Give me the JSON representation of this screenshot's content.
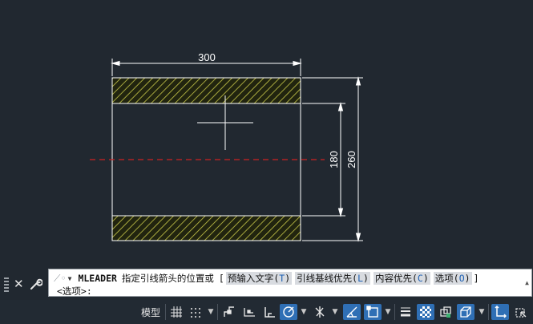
{
  "drawing": {
    "dimensions": {
      "top_width": "300",
      "inner_height": "180",
      "outer_height": "260"
    },
    "colors": {
      "hatch": "#c8c84a",
      "center_line": "#cc2222",
      "lines": "#ffffff",
      "background": "#212830"
    }
  },
  "command_line": {
    "command": "MLEADER",
    "prompt": "指定引线箭头的位置或",
    "bracket_open": "[",
    "bracket_close": "]",
    "options": [
      {
        "label": "预输入文字(",
        "key": "T",
        "close": ")"
      },
      {
        "label": "引线基线优先(",
        "key": "L",
        "close": ")"
      },
      {
        "label": "内容优先(",
        "key": "C",
        "close": ")"
      },
      {
        "label": "选项(",
        "key": "O",
        "close": ")"
      }
    ],
    "second_line": "<选项>:"
  },
  "status_bar": {
    "model_label": "模型",
    "icons": [
      "grid-icon",
      "snap-icon",
      "infer-constraints-icon",
      "dynamic-input-icon",
      "ortho-icon",
      "polar-tracking-icon",
      "isometric-drafting-icon",
      "object-snap-tracking-icon",
      "object-snap-icon",
      "lineweight-icon",
      "transparency-icon",
      "selection-cycling-icon",
      "3d-object-snap-icon",
      "dynamic-ucs-icon"
    ]
  }
}
